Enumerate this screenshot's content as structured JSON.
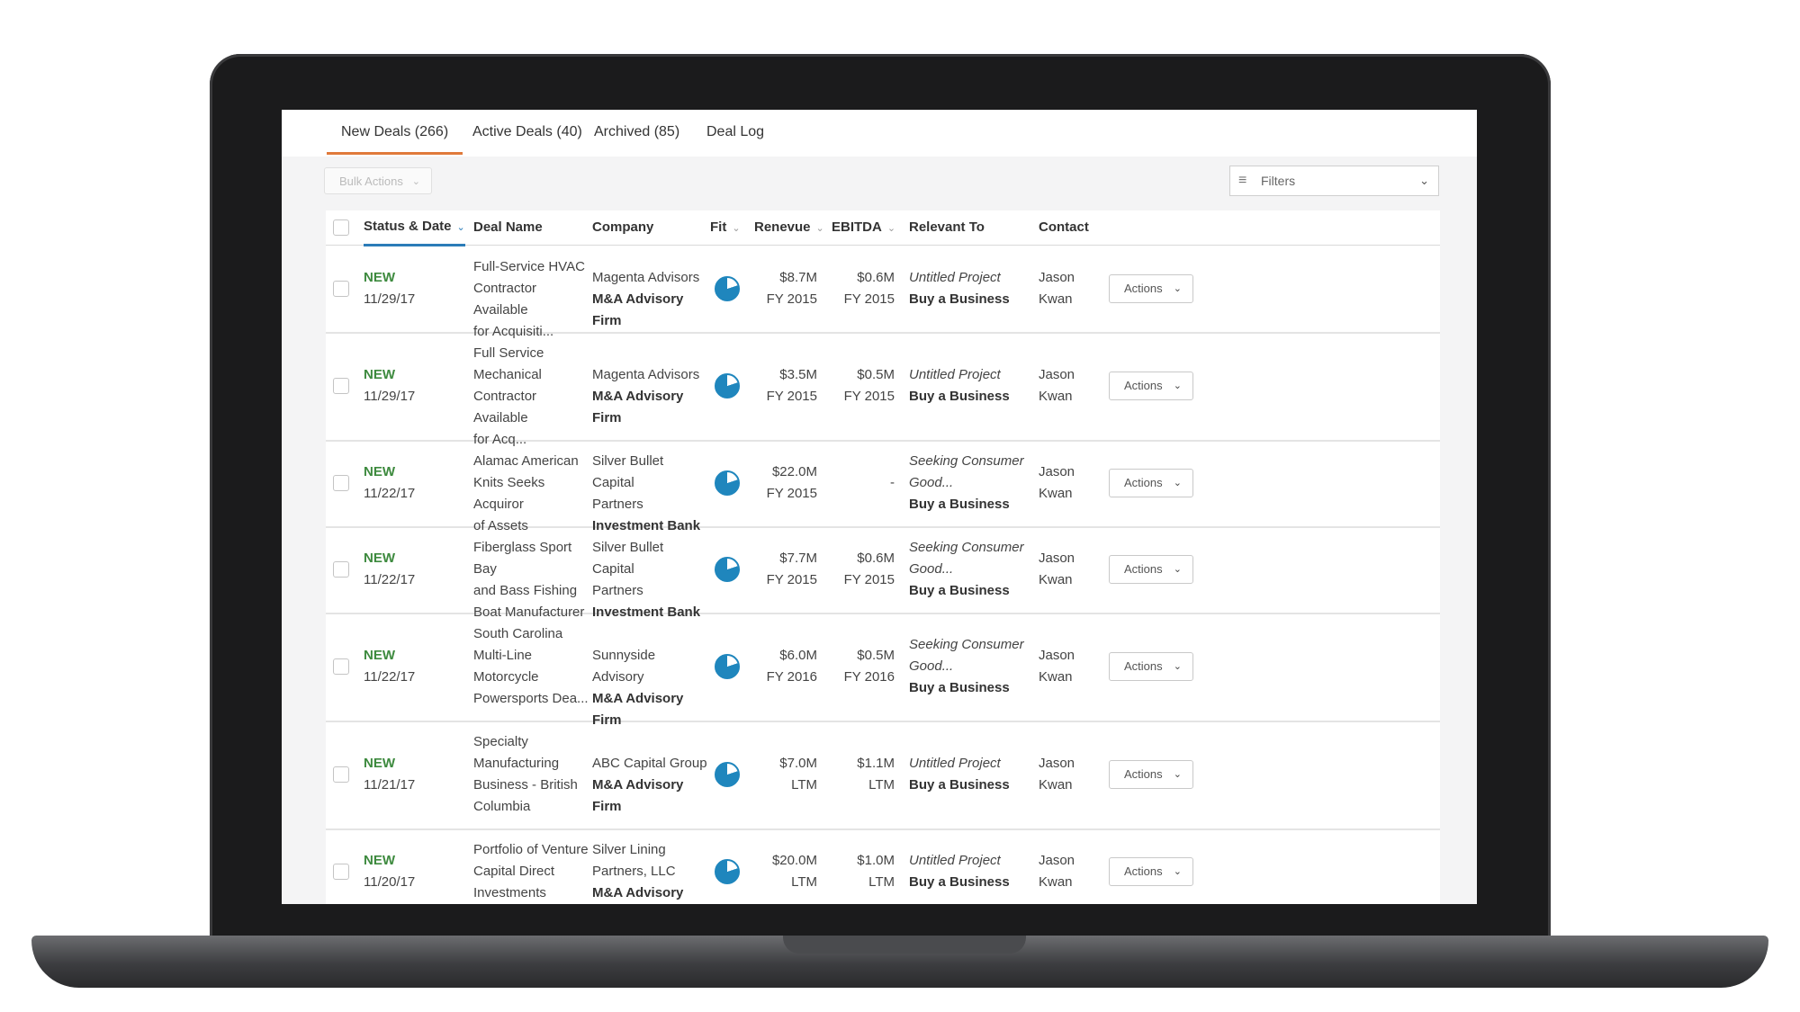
{
  "tabs": [
    {
      "label": "New Deals (266)"
    },
    {
      "label": "Active Deals (40)"
    },
    {
      "label": "Archived (85)"
    },
    {
      "label": "Deal Log"
    }
  ],
  "toolbar": {
    "bulk_actions": "Bulk Actions",
    "filters": "Filters"
  },
  "icons": {
    "chevron": "chevron-down-icon",
    "filter": "filter-icon",
    "fit": "pie-icon"
  },
  "colors": {
    "active_tab": "#e07a3b",
    "sort_accent": "#2b7cb8",
    "status_new": "#3d8a3e",
    "fit": "#1f86bd"
  },
  "table": {
    "headers": {
      "status": "Status & Date",
      "deal": "Deal Name",
      "company": "Company",
      "fit": "Fit",
      "revenue": "Renevue",
      "ebitda": "EBITDA",
      "relevant": "Relevant To",
      "contact": "Contact"
    },
    "actions_label": "Actions",
    "rows": [
      {
        "status": "NEW",
        "date": "11/29/17",
        "deal": [
          "Full-Service HVAC",
          "Contractor Available",
          "for Acquisiti..."
        ],
        "company": [
          "Magenta Advisors"
        ],
        "company_type": "M&A Advisory Firm",
        "rev": "$8.7M",
        "rev_period": "FY 2015",
        "ebitda": "$0.6M",
        "ebitda_period": "FY 2015",
        "relevant": [
          "Untitled Project"
        ],
        "relevant_type": "Buy a Business",
        "contact": [
          "Jason",
          "Kwan"
        ]
      },
      {
        "status": "NEW",
        "date": "11/29/17",
        "deal": [
          "Full Service",
          "Mechanical",
          "Contractor Available",
          "for Acq..."
        ],
        "company": [
          "Magenta Advisors"
        ],
        "company_type": "M&A Advisory Firm",
        "rev": "$3.5M",
        "rev_period": "FY 2015",
        "ebitda": "$0.5M",
        "ebitda_period": "FY 2015",
        "relevant": [
          "Untitled Project"
        ],
        "relevant_type": "Buy a Business",
        "contact": [
          "Jason",
          "Kwan"
        ]
      },
      {
        "status": "NEW",
        "date": "11/22/17",
        "deal": [
          "Alamac American",
          "Knits Seeks Acquiror",
          "of Assets"
        ],
        "company": [
          "Silver Bullet Capital",
          "Partners"
        ],
        "company_type": "Investment Bank",
        "rev": "$22.0M",
        "rev_period": "FY 2015",
        "ebitda": "-",
        "ebitda_period": "",
        "relevant": [
          "Seeking Consumer",
          "Good..."
        ],
        "relevant_type": "Buy a Business",
        "contact": [
          "Jason",
          "Kwan"
        ]
      },
      {
        "status": "NEW",
        "date": "11/22/17",
        "deal": [
          "Fiberglass Sport Bay",
          "and Bass Fishing",
          "Boat Manufacturer"
        ],
        "company": [
          "Silver Bullet Capital",
          "Partners"
        ],
        "company_type": "Investment Bank",
        "rev": "$7.7M",
        "rev_period": "FY 2015",
        "ebitda": "$0.6M",
        "ebitda_period": "FY 2015",
        "relevant": [
          "Seeking Consumer",
          "Good..."
        ],
        "relevant_type": "Buy a Business",
        "contact": [
          "Jason",
          "Kwan"
        ]
      },
      {
        "status": "NEW",
        "date": "11/22/17",
        "deal": [
          "South Carolina",
          "Multi-Line",
          "Motorcycle",
          "Powersports Dea..."
        ],
        "company": [
          "Sunnyside Advisory"
        ],
        "company_type": "M&A Advisory Firm",
        "rev": "$6.0M",
        "rev_period": "FY 2016",
        "ebitda": "$0.5M",
        "ebitda_period": "FY 2016",
        "relevant": [
          "Seeking Consumer",
          "Good..."
        ],
        "relevant_type": "Buy a Business",
        "contact": [
          "Jason",
          "Kwan"
        ]
      },
      {
        "status": "NEW",
        "date": "11/21/17",
        "deal": [
          "Specialty",
          "Manufacturing",
          "Business - British",
          "Columbia"
        ],
        "company": [
          "ABC Capital Group"
        ],
        "company_type": "M&A Advisory Firm",
        "rev": "$7.0M",
        "rev_period": "LTM",
        "ebitda": "$1.1M",
        "ebitda_period": "LTM",
        "relevant": [
          "Untitled Project"
        ],
        "relevant_type": "Buy a Business",
        "contact": [
          "Jason",
          "Kwan"
        ]
      },
      {
        "status": "NEW",
        "date": "11/20/17",
        "deal": [
          "Portfolio of Venture",
          "Capital Direct",
          "Investments"
        ],
        "company": [
          "Silver Lining",
          "Partners, LLC"
        ],
        "company_type": "M&A Advisory Firm",
        "rev": "$20.0M",
        "rev_period": "LTM",
        "ebitda": "$1.0M",
        "ebitda_period": "LTM",
        "relevant": [
          "Untitled Project"
        ],
        "relevant_type": "Buy a Business",
        "contact": [
          "Jason",
          "Kwan"
        ]
      }
    ]
  }
}
